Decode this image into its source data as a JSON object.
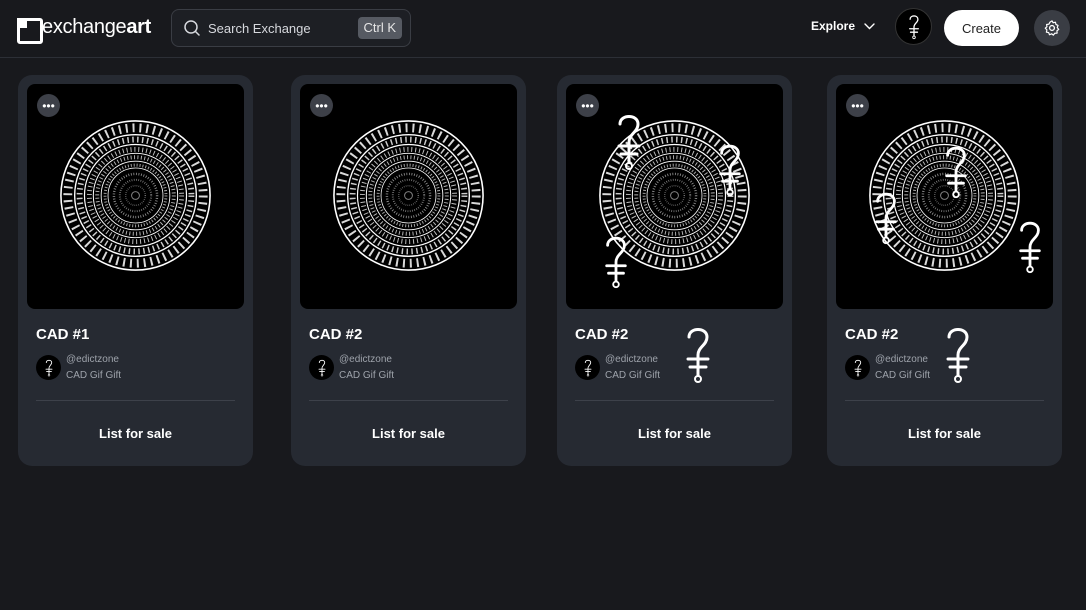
{
  "header": {
    "logo": {
      "text_regular": "exchange",
      "text_bold": "art"
    },
    "search": {
      "placeholder": "Search Exchange",
      "shortcut": "Ctrl K"
    },
    "explore_label": "Explore",
    "create_label": "Create"
  },
  "icons": {
    "logo": "exchange-art-logo-icon",
    "search": "search-icon",
    "chevron": "chevron-down-icon",
    "settings": "gear-icon",
    "more": "more-horizontal-icon"
  },
  "colors": {
    "background": "#18191d",
    "card": "#262a32",
    "muted_text": "#9ea3ab",
    "create_button": "#ffffff"
  },
  "cards": [
    {
      "title": "CAD #1",
      "creator": "@edictzone",
      "collection": "CAD Gif Gift",
      "action": "List for sale"
    },
    {
      "title": "CAD #2",
      "creator": "@edictzone",
      "collection": "CAD Gif Gift",
      "action": "List for sale"
    },
    {
      "title": "CAD #2",
      "creator": "@edictzone",
      "collection": "CAD Gif Gift",
      "action": "List for sale"
    },
    {
      "title": "CAD #2",
      "creator": "@edictzone",
      "collection": "CAD Gif Gift",
      "action": "List for sale"
    }
  ]
}
